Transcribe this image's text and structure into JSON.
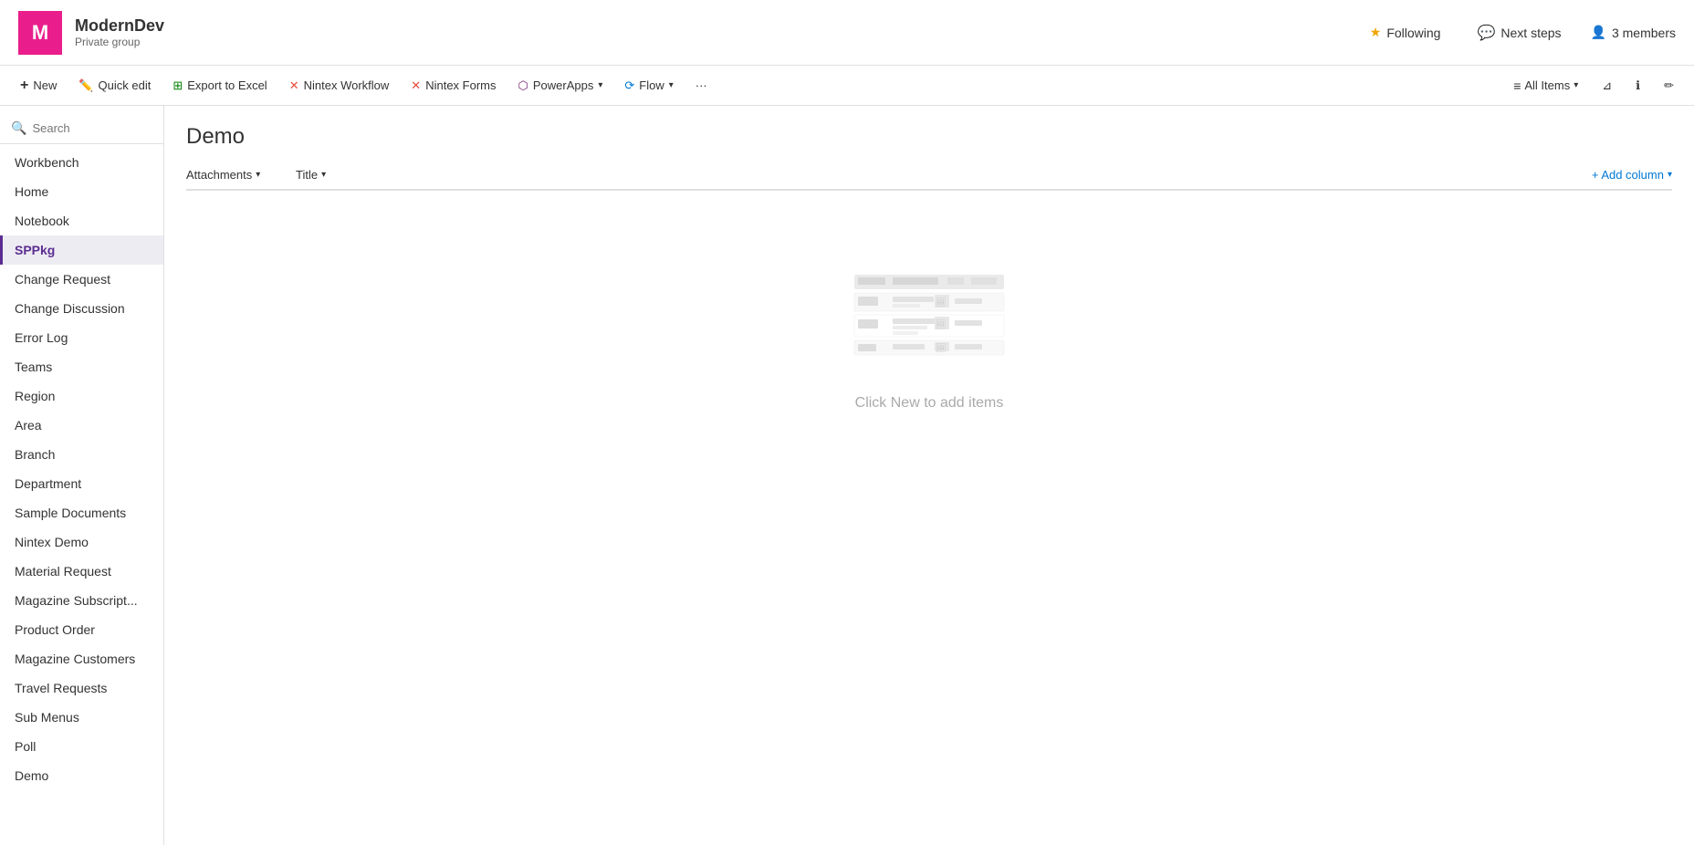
{
  "header": {
    "logo_letter": "M",
    "site_name": "ModernDev",
    "site_subtitle": "Private group",
    "following_label": "Following",
    "next_steps_label": "Next steps",
    "members_label": "3 members"
  },
  "toolbar": {
    "new_label": "New",
    "quick_edit_label": "Quick edit",
    "export_label": "Export to Excel",
    "nintex_workflow_label": "Nintex Workflow",
    "nintex_forms_label": "Nintex Forms",
    "powerapps_label": "PowerApps",
    "flow_label": "Flow",
    "more_label": "···",
    "all_items_label": "All Items",
    "filter_label": "",
    "info_label": "",
    "edit_label": ""
  },
  "sidebar": {
    "search_placeholder": "Search",
    "items": [
      {
        "label": "Workbench",
        "active": false
      },
      {
        "label": "Home",
        "active": false
      },
      {
        "label": "Notebook",
        "active": false
      },
      {
        "label": "SPPkg",
        "active": true
      },
      {
        "label": "Change Request",
        "active": false
      },
      {
        "label": "Change Discussion",
        "active": false
      },
      {
        "label": "Error Log",
        "active": false
      },
      {
        "label": "Teams",
        "active": false
      },
      {
        "label": "Region",
        "active": false
      },
      {
        "label": "Area",
        "active": false
      },
      {
        "label": "Branch",
        "active": false
      },
      {
        "label": "Department",
        "active": false
      },
      {
        "label": "Sample Documents",
        "active": false
      },
      {
        "label": "Nintex Demo",
        "active": false
      },
      {
        "label": "Material Request",
        "active": false
      },
      {
        "label": "Magazine Subscript...",
        "active": false
      },
      {
        "label": "Product Order",
        "active": false
      },
      {
        "label": "Magazine Customers",
        "active": false
      },
      {
        "label": "Travel Requests",
        "active": false
      },
      {
        "label": "Sub Menus",
        "active": false
      },
      {
        "label": "Poll",
        "active": false
      },
      {
        "label": "Demo",
        "active": false
      }
    ]
  },
  "content": {
    "page_title": "Demo",
    "col_attachments": "Attachments",
    "col_title": "Title",
    "add_column_label": "+ Add column",
    "empty_message": "Click New to add items"
  },
  "colors": {
    "accent": "#5c2d91",
    "logo_bg": "#e91e8c",
    "link": "#0078d4",
    "star": "#f0a500"
  }
}
